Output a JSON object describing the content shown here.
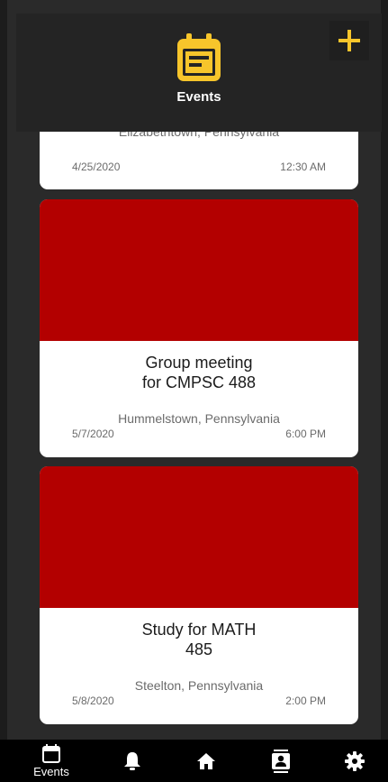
{
  "header": {
    "title": "Events",
    "add_label": "+",
    "accent_color": "#f7c52b"
  },
  "events": [
    {
      "title": "",
      "location": "Elizabethtown, Pennsylvania",
      "date": "4/25/2020",
      "time": "12:30 AM"
    },
    {
      "title": "Group meeting for CMPSC 488",
      "title_line1": "Group meeting",
      "title_line2": "for CMPSC 488",
      "location": "Hummelstown, Pennsylvania",
      "date": "5/7/2020",
      "time": "6:00 PM",
      "image_color": "#b30000"
    },
    {
      "title": "Study for MATH 485",
      "title_line1": "Study for MATH",
      "title_line2": "485",
      "location": "Steelton, Pennsylvania",
      "date": "5/8/2020",
      "time": "2:00 PM",
      "image_color": "#b30000"
    }
  ],
  "bottom_nav": {
    "items": [
      {
        "label": "Events",
        "icon": "calendar-icon",
        "active": true
      },
      {
        "label": "",
        "icon": "bell-icon"
      },
      {
        "label": "",
        "icon": "home-icon"
      },
      {
        "label": "",
        "icon": "contacts-icon"
      },
      {
        "label": "",
        "icon": "gear-icon"
      }
    ]
  }
}
